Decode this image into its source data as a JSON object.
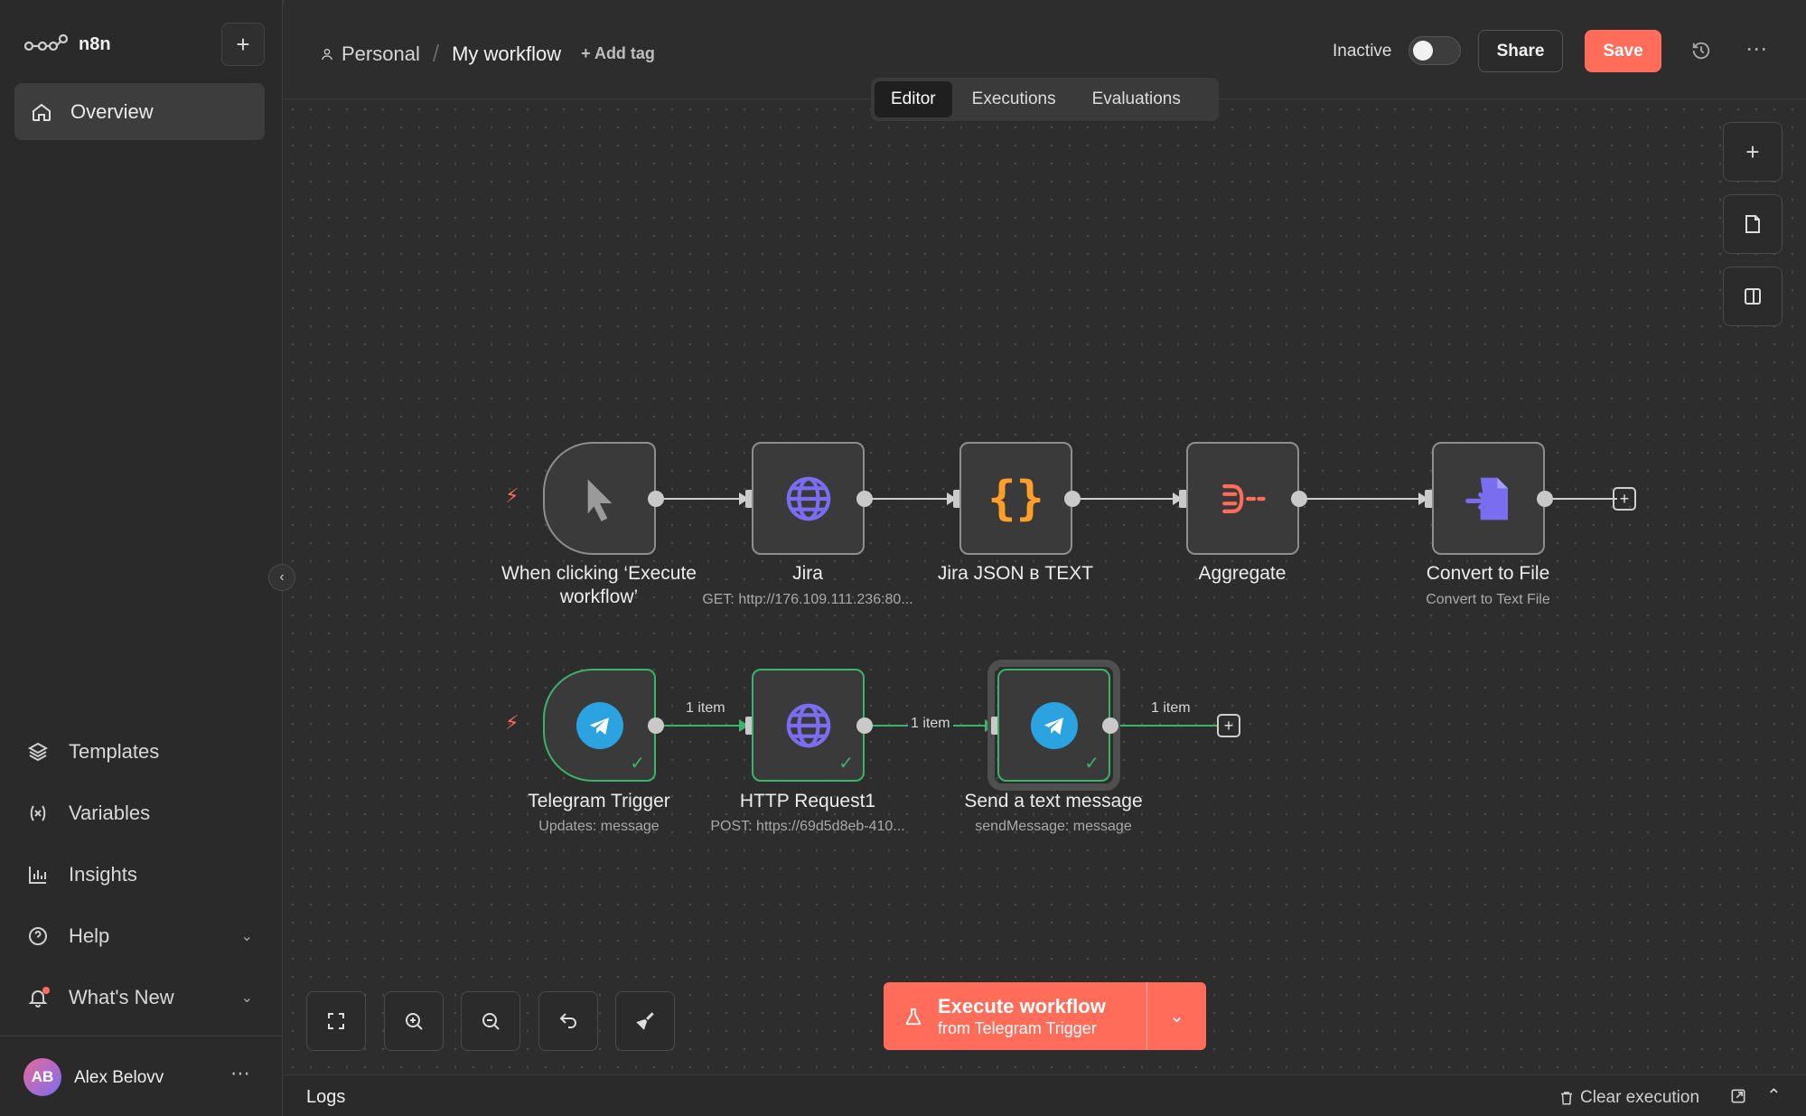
{
  "app": {
    "name": "n8n"
  },
  "sidebar": {
    "overview": "Overview",
    "items": [
      {
        "label": "Templates",
        "icon": "templates-icon"
      },
      {
        "label": "Variables",
        "icon": "variables-icon"
      },
      {
        "label": "Insights",
        "icon": "insights-icon"
      },
      {
        "label": "Help",
        "icon": "help-icon"
      },
      {
        "label": "What's New",
        "icon": "bell-icon"
      }
    ],
    "user": {
      "initials": "AB",
      "name": "Alex Belovv"
    }
  },
  "header": {
    "project": "Personal",
    "separator": "/",
    "workflow_name": "My workflow",
    "add_tag": "+ Add tag",
    "status": "Inactive",
    "share": "Share",
    "save": "Save"
  },
  "tabs": [
    "Editor",
    "Executions",
    "Evaluations"
  ],
  "workflow": {
    "row1": [
      {
        "label": "When clicking ‘Execute workflow’",
        "sub": ""
      },
      {
        "label": "Jira",
        "sub": "GET: http://176.109.111.236:80..."
      },
      {
        "label": "Jira JSON в TEXT",
        "sub": ""
      },
      {
        "label": "Aggregate",
        "sub": ""
      },
      {
        "label": "Convert to File",
        "sub": "Convert to Text File"
      }
    ],
    "row2": [
      {
        "label": "Telegram Trigger",
        "sub": "Updates: message"
      },
      {
        "label": "HTTP Request1",
        "sub": "POST: https://69d5d8eb-410..."
      },
      {
        "label": "Send a text message",
        "sub": "sendMessage: message"
      }
    ],
    "items_labels": [
      "1 item",
      "1 item",
      "1 item"
    ]
  },
  "execute": {
    "title": "Execute workflow",
    "subtitle": "from Telegram Trigger"
  },
  "logs": {
    "title": "Logs",
    "clear": "Clear execution"
  },
  "colors": {
    "accent": "#ff6d5a",
    "success": "#3bb36a",
    "telegram": "#2aa3e0",
    "jira": "#7b6df0"
  }
}
